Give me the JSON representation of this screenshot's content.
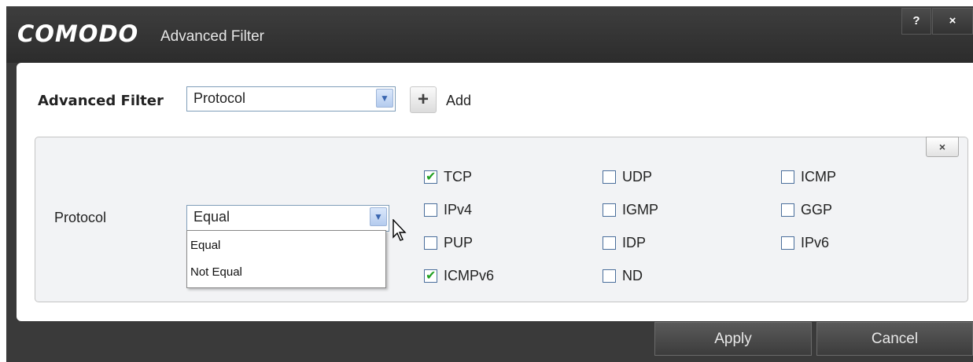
{
  "window": {
    "logo": "COMODO",
    "title": "Advanced Filter",
    "help_label": "?",
    "close_label": "×"
  },
  "filter": {
    "label": "Advanced Filter",
    "selected": "Protocol",
    "add_label": "Add",
    "add_symbol": "+"
  },
  "panel": {
    "close_label": "×",
    "protocol_label": "Protocol",
    "condition_selected": "Equal",
    "condition_options": [
      "Equal",
      "Not Equal"
    ],
    "protocols": [
      {
        "label": "TCP",
        "checked": true
      },
      {
        "label": "UDP",
        "checked": false
      },
      {
        "label": "ICMP",
        "checked": false
      },
      {
        "label": "IPv4",
        "checked": false
      },
      {
        "label": "IGMP",
        "checked": false
      },
      {
        "label": "GGP",
        "checked": false
      },
      {
        "label": "PUP",
        "checked": false
      },
      {
        "label": "IDP",
        "checked": false
      },
      {
        "label": "IPv6",
        "checked": false
      },
      {
        "label": "ICMPv6",
        "checked": true
      },
      {
        "label": "ND",
        "checked": false
      }
    ]
  },
  "footer": {
    "apply_label": "Apply",
    "cancel_label": "Cancel"
  },
  "colors": {
    "titlebar": "#333333",
    "check_tick": "#22a022"
  }
}
